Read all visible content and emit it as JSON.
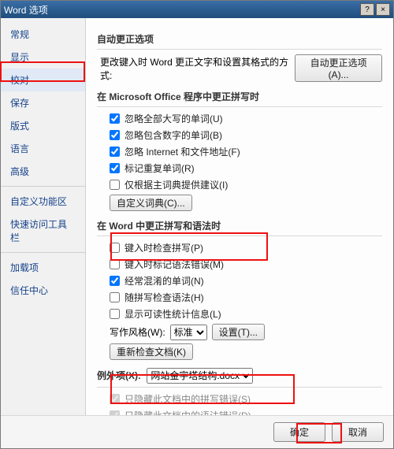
{
  "window": {
    "title": "Word 选项",
    "help": "?",
    "close": "×"
  },
  "sidebar": {
    "items": [
      {
        "label": "常规"
      },
      {
        "label": "显示"
      },
      {
        "label": "校对"
      },
      {
        "label": "保存"
      },
      {
        "label": "版式"
      },
      {
        "label": "语言"
      },
      {
        "label": "高级"
      },
      {
        "label": "自定义功能区"
      },
      {
        "label": "快速访问工具栏"
      },
      {
        "label": "加载项"
      },
      {
        "label": "信任中心"
      }
    ]
  },
  "main": {
    "autocorrect": {
      "title": "自动更正选项",
      "desc": "更改键入时 Word 更正文字和设置其格式的方式:",
      "button": "自动更正选项(A)..."
    },
    "office_spell": {
      "title": "在 Microsoft Office 程序中更正拼写时",
      "c1": "忽略全部大写的单词(U)",
      "c2": "忽略包含数字的单词(B)",
      "c3": "忽略 Internet 和文件地址(F)",
      "c4": "标记重复单词(R)",
      "c5": "仅根据主词典提供建议(I)",
      "dict_btn": "自定义词典(C)..."
    },
    "word_spell": {
      "title": "在 Word 中更正拼写和语法时",
      "c1": "键入时检查拼写(P)",
      "c2": "键入时标记语法错误(M)",
      "c3": "经常混淆的单词(N)",
      "c4": "随拼写检查语法(H)",
      "c5": "显示可读性统计信息(L)",
      "style_label": "写作风格(W):",
      "style_value": "标准",
      "settings_btn": "设置(T)...",
      "recheck_btn": "重新检查文档(K)"
    },
    "exceptions": {
      "title_label": "例外项(X):",
      "doc": "网站金字塔结构.docx",
      "c1": "只隐藏此文档中的拼写错误(S)",
      "c2": "只隐藏此文档中的语法错误(D)"
    }
  },
  "footer": {
    "ok": "确定",
    "cancel": "取消"
  }
}
